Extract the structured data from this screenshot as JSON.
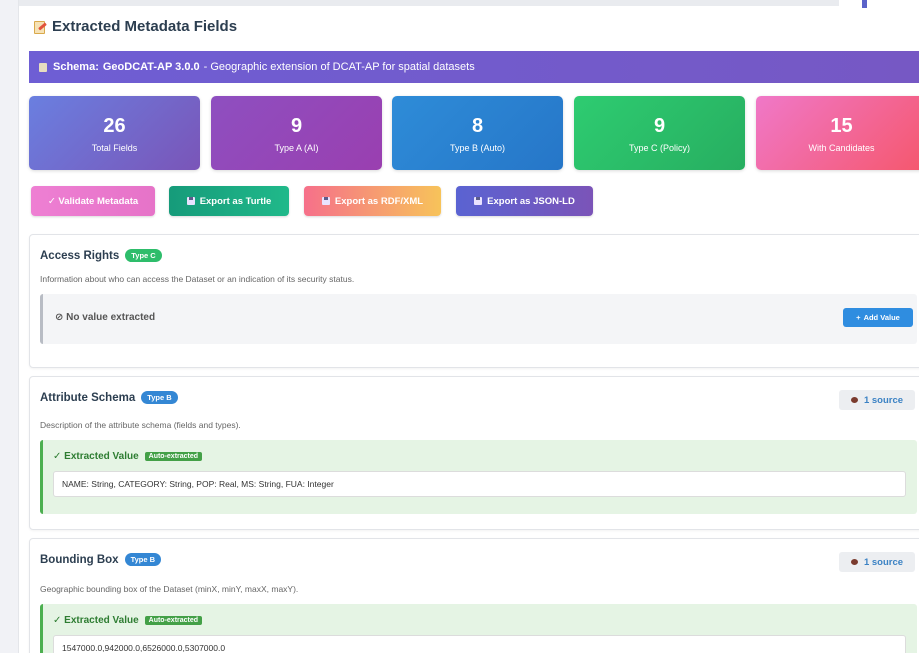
{
  "page": {
    "title": "Extracted Metadata Fields",
    "title_icon": "memo-icon"
  },
  "schema": {
    "label": "Schema:",
    "name": "GeoDCAT-AP 3.0.0",
    "description": " - Geographic extension of DCAT-AP for spatial datasets",
    "icon": "book-icon"
  },
  "stats": [
    {
      "value": "26",
      "label": "Total Fields",
      "color_from": "#6a7fe0",
      "color_to": "#7a55b8"
    },
    {
      "value": "9",
      "label": "Type A (AI)",
      "color_from": "#8e4fc0",
      "color_to": "#9a3fb0"
    },
    {
      "value": "8",
      "label": "Type B (Auto)",
      "color_from": "#2e8cd8",
      "color_to": "#2676c8"
    },
    {
      "value": "9",
      "label": "Type C (Policy)",
      "color_from": "#2ecc71",
      "color_to": "#27ae60"
    },
    {
      "value": "15",
      "label": "With Candidates",
      "color_from": "#f078c8",
      "color_to": "#f5576c"
    }
  ],
  "actions": {
    "validate": "✓ Validate Metadata",
    "turtle": "Export as Turtle",
    "rdfxml": "Export as RDF/XML",
    "jsonld": "Export as JSON-LD"
  },
  "fields": [
    {
      "name": "Access Rights",
      "type_badge": "Type C",
      "description": "Information about who can access the Dataset or an indication of its security status.",
      "no_value": "⊘ No value extracted",
      "add_value": "Add Value"
    },
    {
      "name": "Attribute Schema",
      "type_badge": "Type B",
      "description": "Description of the attribute schema (fields and types).",
      "source": "1 source",
      "extracted_label": "✓ Extracted Value",
      "auto_label": "Auto-extracted",
      "value": "NAME: String, CATEGORY: String, POP: Real, MS: String, FUA: Integer"
    },
    {
      "name": "Bounding Box",
      "type_badge": "Type B",
      "description": "Geographic bounding box of the Dataset (minX, minY, maxX, maxY).",
      "source": "1 source",
      "extracted_label": "✓ Extracted Value",
      "auto_label": "Auto-extracted",
      "value": "1547000.0,942000.0,6526000.0,5307000.0"
    }
  ]
}
